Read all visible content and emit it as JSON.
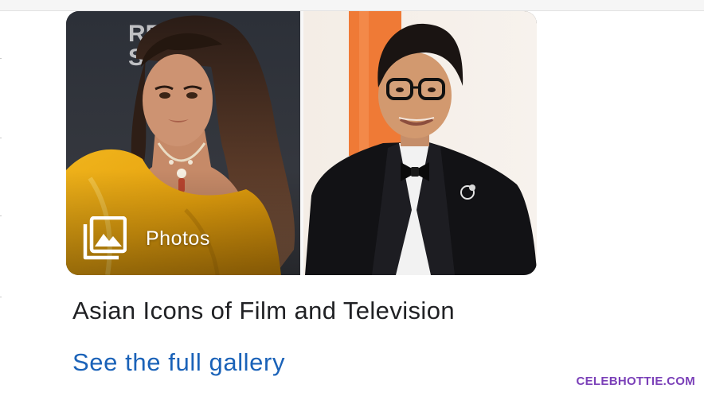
{
  "gallery_card": {
    "badge_label": "Photos",
    "badge_icon": "photo-library-icon",
    "left_photo_subject": "woman-in-yellow-gown",
    "right_photo_subject": "man-in-tuxedo"
  },
  "gallery": {
    "title": "Asian Icons of Film and Television",
    "link_label": "See the full gallery",
    "link_color": "#1a62b8"
  },
  "watermark": {
    "text": "CELEBHOTTIE.COM",
    "color": "#7a3fb8"
  }
}
